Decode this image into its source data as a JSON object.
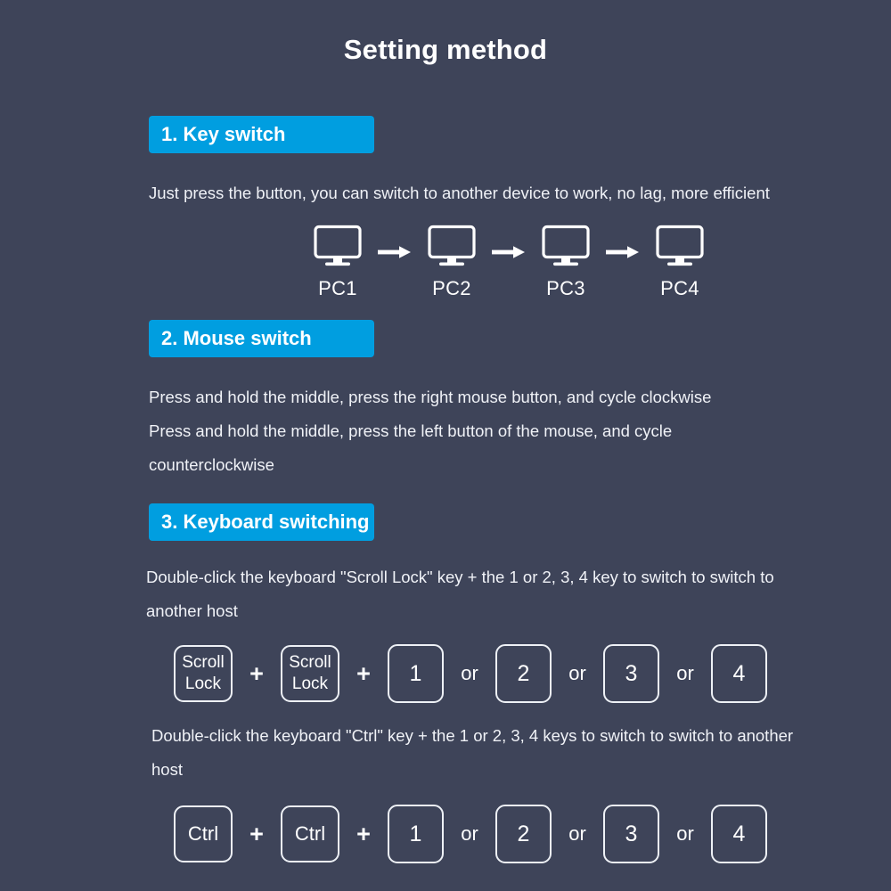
{
  "theme": {
    "background": "#3e4459",
    "accent_blue": "#009ee0",
    "text": "#f0f2f7",
    "key_outline": "#eef1f6"
  },
  "header": {
    "title": "Setting method"
  },
  "sections": [
    {
      "id": "key-switch",
      "badge": "1. Key switch",
      "paragraphs": [
        "Just press the button, you can switch to another device to work, no lag, more efficient"
      ],
      "diagram": {
        "type": "pc-chain",
        "icon": "monitor-icon",
        "connector_icon": "arrow-right-icon",
        "nodes": [
          "PC1",
          "PC2",
          "PC3",
          "PC4"
        ]
      }
    },
    {
      "id": "mouse-switch",
      "badge": "2. Mouse switch",
      "paragraphs": [
        "Press and hold the middle, press the right mouse button, and cycle clockwise",
        "Press and hold the middle, press the left button of the mouse, and cycle counterclockwise"
      ]
    },
    {
      "id": "keyboard-switching",
      "badge": "3. Keyboard switching",
      "paragraphs": [
        "Double-click the keyboard \"Scroll Lock\" key + the 1 or 2, 3, 4 key to switch to switch to another host",
        "Double-click the keyboard \"Ctrl\" key + the 1 or 2, 3, 4 keys to switch to switch to another host"
      ],
      "key_combos": [
        {
          "id": "scroll-lock-combo",
          "modifier_line1": "Scroll",
          "modifier_line2": "Lock",
          "plus": "+",
          "or": "or",
          "numbers": [
            "1",
            "2",
            "3",
            "4"
          ]
        },
        {
          "id": "ctrl-combo",
          "modifier_line1": "Ctrl",
          "modifier_line2": "",
          "plus": "+",
          "or": "or",
          "numbers": [
            "1",
            "2",
            "3",
            "4"
          ]
        }
      ]
    }
  ]
}
